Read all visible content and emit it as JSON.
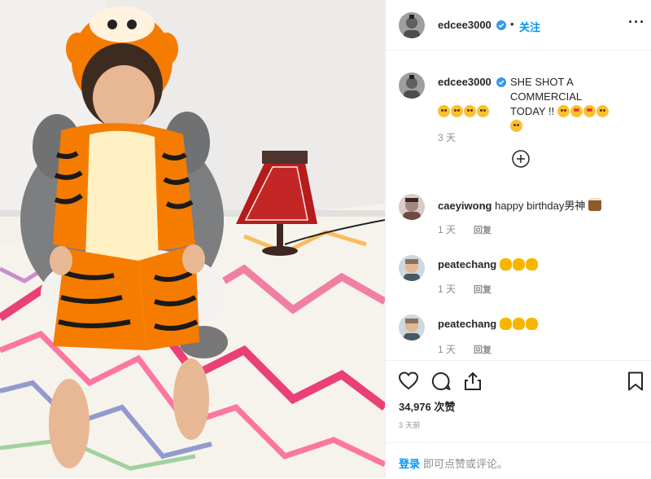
{
  "post": {
    "username": "edcee3000",
    "follow_label": "关注",
    "dot": "•",
    "more_label": "···"
  },
  "caption": {
    "username": "edcee3000",
    "text": "SHE SHOT A COMMERCIAL TODAY !!",
    "time": "3 天"
  },
  "comments": [
    {
      "username": "caeyiwong",
      "text": "happy birthday男神",
      "time": "1 天",
      "reply": "回复"
    },
    {
      "username": "peatechang",
      "text": "",
      "time": "1 天",
      "reply": "回复"
    },
    {
      "username": "peatechang",
      "text": "",
      "time": "1 天",
      "reply": "回复"
    }
  ],
  "footer": {
    "likes": "34,976 次赞",
    "timestamp": "3 天前",
    "login_link": "登录",
    "login_rest": "即可点赞或评论。"
  },
  "colors": {
    "accent": "#0095f6",
    "muted": "#8e8e8e",
    "text": "#262626",
    "border": "#efefef"
  },
  "icons": [
    "verified-badge-icon",
    "more-options-icon",
    "load-more-icon",
    "heart-icon",
    "comment-icon",
    "share-icon",
    "bookmark-icon"
  ]
}
